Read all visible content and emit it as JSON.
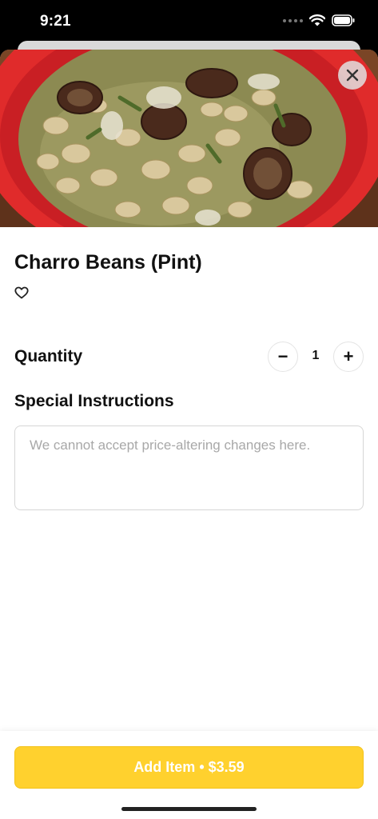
{
  "status_bar": {
    "time": "9:21",
    "icons": [
      "signal-dots-icon",
      "wifi-icon",
      "battery-icon"
    ]
  },
  "item": {
    "title": "Charro Beans (Pint)",
    "image_subject": "bowl of charro beans with sausage"
  },
  "quantity": {
    "label": "Quantity",
    "value": "1",
    "decrement": "−",
    "increment": "+"
  },
  "instructions": {
    "label": "Special Instructions",
    "placeholder": "We cannot accept price-altering changes here.",
    "value": ""
  },
  "footer": {
    "add_button_label": "Add Item • $3.59"
  },
  "colors": {
    "accent": "#ffd12e",
    "bowl": "#e02b2b",
    "text": "#111111",
    "placeholder": "#a8a8a8"
  }
}
